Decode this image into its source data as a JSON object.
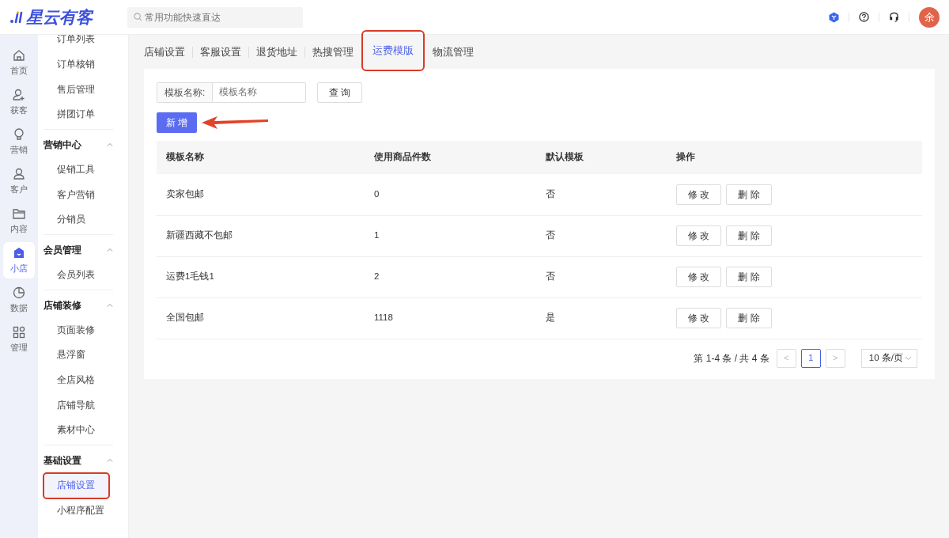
{
  "brand": {
    "name": "星云有客"
  },
  "search": {
    "placeholder": "常用功能快速直达"
  },
  "user": {
    "avatar_text": "余"
  },
  "rail": [
    {
      "label": "首页",
      "selected": false
    },
    {
      "label": "获客",
      "selected": false
    },
    {
      "label": "营销",
      "selected": false
    },
    {
      "label": "客户",
      "selected": false
    },
    {
      "label": "内容",
      "selected": false
    },
    {
      "label": "小店",
      "selected": true
    },
    {
      "label": "数据",
      "selected": false
    },
    {
      "label": "管理",
      "selected": false
    }
  ],
  "sidebar": {
    "groups": [
      {
        "items": [
          {
            "label": "订单列表",
            "selected": false,
            "highlighted": false
          },
          {
            "label": "订单核销",
            "selected": false,
            "highlighted": false
          },
          {
            "label": "售后管理",
            "selected": false,
            "highlighted": false
          },
          {
            "label": "拼团订单",
            "selected": false,
            "highlighted": false
          }
        ]
      },
      {
        "title": "营销中心",
        "expanded": true,
        "items": [
          {
            "label": "促销工具",
            "selected": false,
            "highlighted": false
          },
          {
            "label": "客户营销",
            "selected": false,
            "highlighted": false
          },
          {
            "label": "分销员",
            "selected": false,
            "highlighted": false
          }
        ]
      },
      {
        "title": "会员管理",
        "expanded": true,
        "items": [
          {
            "label": "会员列表",
            "selected": false,
            "highlighted": false
          }
        ]
      },
      {
        "title": "店铺装修",
        "expanded": true,
        "items": [
          {
            "label": "页面装修",
            "selected": false,
            "highlighted": false
          },
          {
            "label": "悬浮窗",
            "selected": false,
            "highlighted": false
          },
          {
            "label": "全店风格",
            "selected": false,
            "highlighted": false
          },
          {
            "label": "店铺导航",
            "selected": false,
            "highlighted": false
          },
          {
            "label": "素材中心",
            "selected": false,
            "highlighted": false
          }
        ]
      },
      {
        "title": "基础设置",
        "expanded": true,
        "items": [
          {
            "label": "店铺设置",
            "selected": true,
            "highlighted": true
          },
          {
            "label": "小程序配置",
            "selected": false,
            "highlighted": false
          }
        ]
      }
    ]
  },
  "tabs": [
    {
      "label": "店铺设置",
      "selected": false,
      "highlighted": false
    },
    {
      "label": "客服设置",
      "selected": false,
      "highlighted": false
    },
    {
      "label": "退货地址",
      "selected": false,
      "highlighted": false
    },
    {
      "label": "热搜管理",
      "selected": false,
      "highlighted": false
    },
    {
      "label": "运费模版",
      "selected": true,
      "highlighted": true
    },
    {
      "label": "物流管理",
      "selected": false,
      "highlighted": false
    }
  ],
  "filter": {
    "label": "模板名称:",
    "placeholder": "模板名称",
    "button": "查 询"
  },
  "add_button": {
    "label": "新 增",
    "pointed": true
  },
  "table": {
    "columns": [
      "模板名称",
      "使用商品件数",
      "默认模板",
      "操作"
    ],
    "rows": [
      {
        "name": "卖家包邮",
        "count": "0",
        "default": "否",
        "actions": [
          "修 改",
          "删 除"
        ]
      },
      {
        "name": "新疆西藏不包邮",
        "count": "1",
        "default": "否",
        "actions": [
          "修 改",
          "删 除"
        ]
      },
      {
        "name": "运费1毛钱1",
        "count": "2",
        "default": "否",
        "actions": [
          "修 改",
          "删 除"
        ]
      },
      {
        "name": "全国包邮",
        "count": "1118",
        "default": "是",
        "actions": [
          "修 改",
          "删 除"
        ]
      }
    ]
  },
  "pagination": {
    "summary": "第 1-4 条 / 共 4 条",
    "prev": "<",
    "pages": [
      {
        "label": "1",
        "selected": true
      }
    ],
    "next": ">",
    "page_size": "10 条/页"
  }
}
